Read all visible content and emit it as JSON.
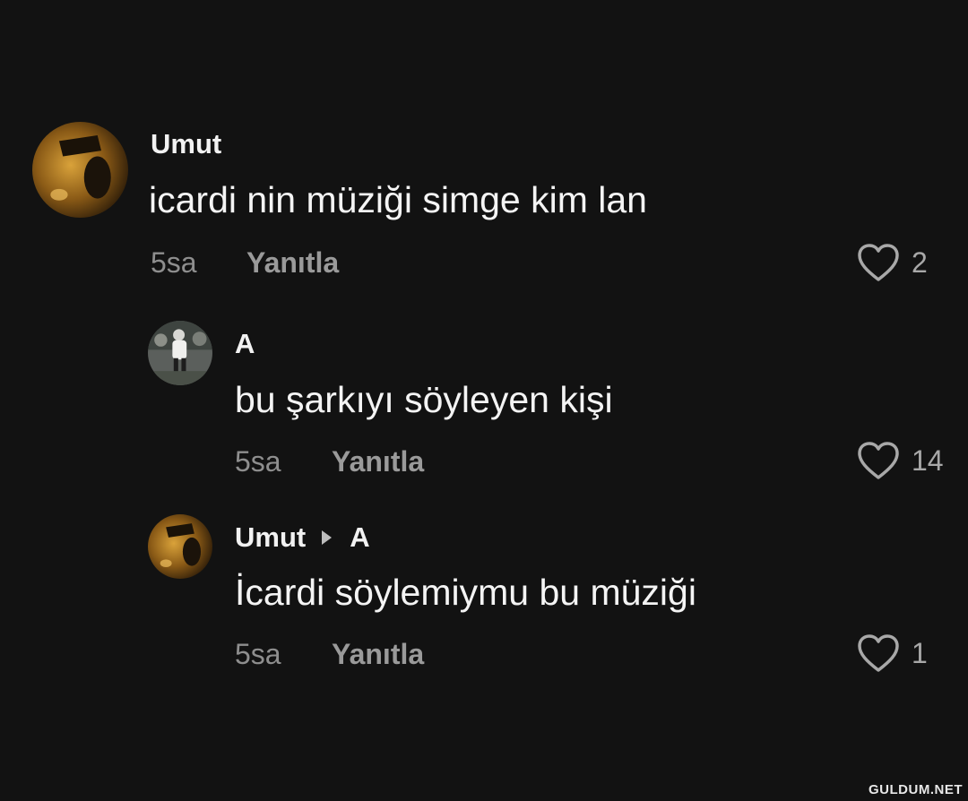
{
  "comments": [
    {
      "username": "Umut",
      "text": "icardi nin müziği simge kim lan",
      "time": "5sa",
      "reply_label": "Yanıtla",
      "likes": "2",
      "avatar_icon": "avatar-photo-icon"
    },
    {
      "username": "A",
      "text": "bu şarkıyı söyleyen kişi",
      "time": "5sa",
      "reply_label": "Yanıtla",
      "likes": "14",
      "avatar_icon": "avatar-photo-icon"
    },
    {
      "username": "Umut",
      "reply_to": "A",
      "text": "İcardi söylemiymu bu müziği",
      "time": "5sa",
      "reply_label": "Yanıtla",
      "likes": "1",
      "avatar_icon": "avatar-photo-icon"
    }
  ],
  "watermark": "GULDUM.NET",
  "colors": {
    "background": "#121212",
    "text": "#f4f4f4",
    "muted": "#8e8e8e"
  }
}
